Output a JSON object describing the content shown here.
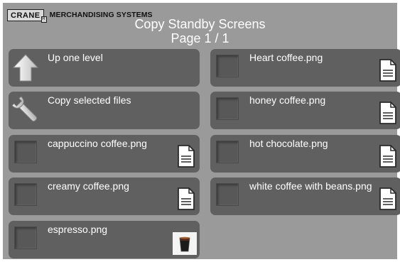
{
  "brand": {
    "logo": "CRANE",
    "registered": "R",
    "name": "MERCHANDISING SYSTEMS"
  },
  "header": {
    "title": "Copy Standby Screens",
    "page": "Page 1 / 1"
  },
  "actions": {
    "up": {
      "label": "Up one level",
      "icon": "up-arrow-icon"
    },
    "copy": {
      "label": "Copy selected files",
      "icon": "wrench-icon"
    }
  },
  "files": [
    {
      "label": "cappuccino coffee.png",
      "icon": "document-icon"
    },
    {
      "label": "creamy coffee.png",
      "icon": "document-icon"
    },
    {
      "label": "espresso.png",
      "icon": "espresso-thumbnail"
    },
    {
      "label": "Heart coffee.png",
      "icon": "document-icon"
    },
    {
      "label": "honey coffee.png",
      "icon": "document-icon"
    },
    {
      "label": "hot chocolate.png",
      "icon": "document-icon"
    },
    {
      "label": "white coffee with beans.png",
      "icon": "document-icon"
    }
  ],
  "colors": {
    "background": "#9a9a9a",
    "tile": "#606060",
    "text": "#ffffff"
  }
}
